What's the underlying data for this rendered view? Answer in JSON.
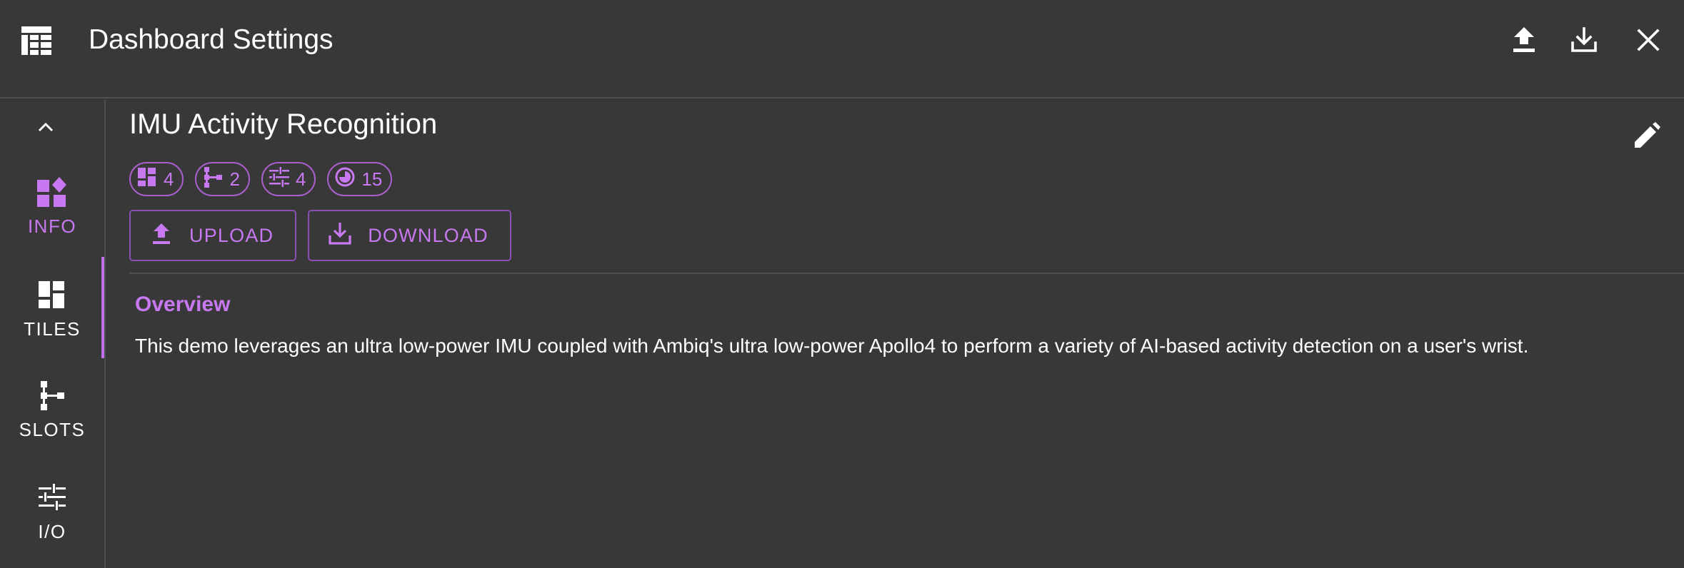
{
  "header": {
    "title": "Dashboard Settings",
    "icons": {
      "app": "dashboard-table-icon",
      "upload": "upload-icon",
      "download": "download-icon",
      "close": "close-icon"
    }
  },
  "sidebar": {
    "collapse_icon": "chevron-up-icon",
    "items": [
      {
        "label": "INFO",
        "icon": "widgets-icon",
        "active": true
      },
      {
        "label": "TILES",
        "icon": "dashboard-tiles-icon",
        "active": false
      },
      {
        "label": "SLOTS",
        "icon": "tree-slots-icon",
        "active": false
      },
      {
        "label": "I/O",
        "icon": "tune-sliders-icon",
        "active": false
      }
    ]
  },
  "main": {
    "title": "IMU Activity Recognition",
    "chips": [
      {
        "icon": "tiles-icon",
        "value": "4"
      },
      {
        "icon": "slots-icon",
        "value": "2"
      },
      {
        "icon": "io-icon",
        "value": "4"
      },
      {
        "icon": "timer-icon",
        "value": "15"
      }
    ],
    "buttons": {
      "upload": "UPLOAD",
      "download": "DOWNLOAD"
    },
    "overview": {
      "heading": "Overview",
      "text": "This demo leverages an ultra low-power IMU coupled with Ambiq's ultra low-power Apollo4 to perform a variety of AI-based activity detection on a user's wrist."
    }
  },
  "colors": {
    "background": "#383838",
    "accent": "#c878f0",
    "divider": "#4f4f4f",
    "text": "#ffffff"
  }
}
